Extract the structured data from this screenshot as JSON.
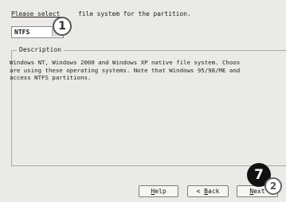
{
  "dialog": {
    "prompt_pre": "Please select",
    "prompt_post": "file system for the partition."
  },
  "filesystem_select": {
    "value": "NTFS"
  },
  "description": {
    "legend": "Description",
    "lines": [
      "Windows NT, Windows 2000 and Windows XP native file system. Choos",
      "are using these operating systems. Note that Windows 95/98/ME and",
      "access NTFS partitions."
    ]
  },
  "buttons": {
    "help": {
      "underlined": "H",
      "rest": "elp"
    },
    "back": {
      "prefix": "< ",
      "underlined": "B",
      "rest": "ack"
    },
    "next": {
      "underlined": "N",
      "rest": "ext"
    }
  },
  "callouts": {
    "one": "1",
    "two": "2",
    "seven": "7"
  },
  "icons": {
    "dropdown": "chevron-down-icon"
  }
}
